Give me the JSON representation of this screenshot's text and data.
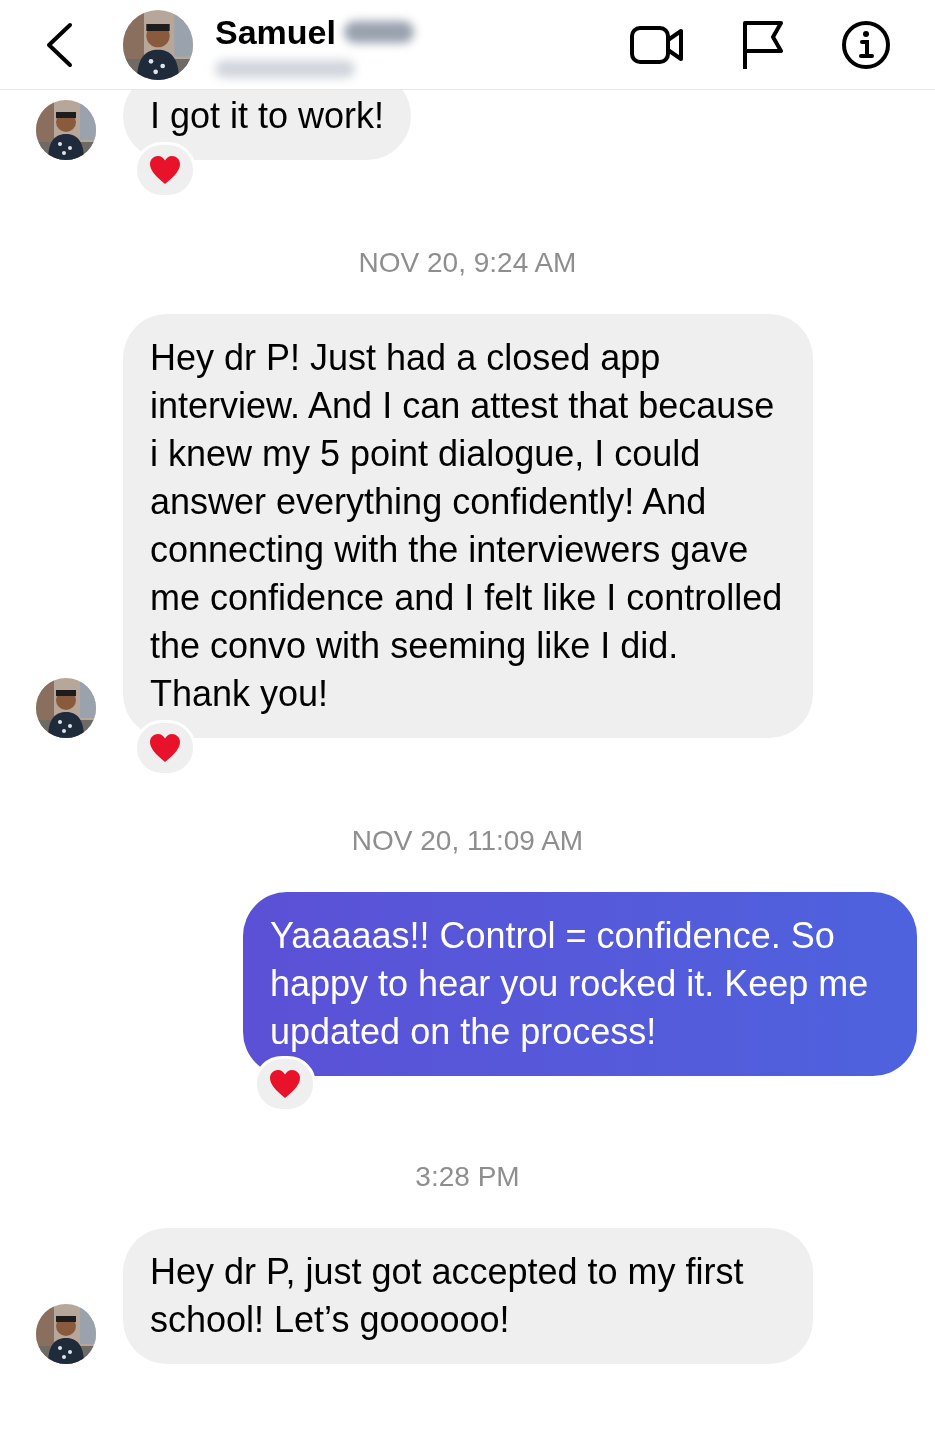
{
  "header": {
    "name": "Samuel",
    "surname_blurred": true,
    "subtitle_blurred": true
  },
  "messages": [
    {
      "kind": "received",
      "text": "I got it to work!",
      "hearted": true
    },
    {
      "kind": "timestamp",
      "text": "NOV 20, 9:24 AM"
    },
    {
      "kind": "received",
      "text": "Hey dr P! Just had a closed app interview. And I can attest that because i knew my 5 point dialogue, I could answer everything confidently! And connecting with the interviewers gave me confidence and I felt like I controlled the convo with seeming like I did. Thank you!",
      "hearted": true
    },
    {
      "kind": "timestamp",
      "text": "NOV 20, 11:09 AM"
    },
    {
      "kind": "sent",
      "text": "Yaaaaas!! Control = confidence. So happy to hear you rocked it. Keep me updated on the process!",
      "hearted": true
    },
    {
      "kind": "timestamp",
      "text": "3:28 PM"
    },
    {
      "kind": "received",
      "text": "Hey dr P, just got accepted to my first school! Let’s goooooo!",
      "hearted": false
    }
  ]
}
